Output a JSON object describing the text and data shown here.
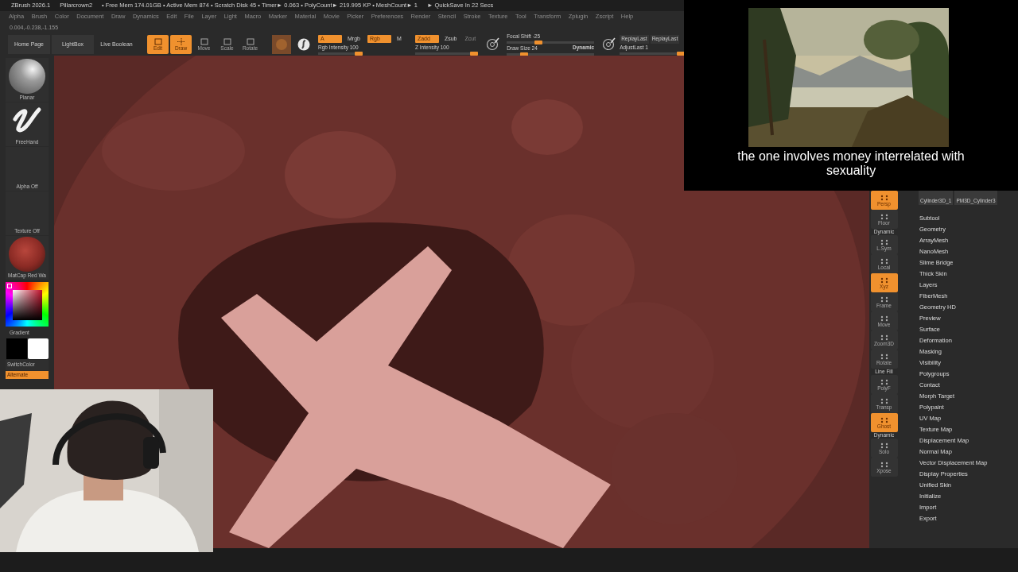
{
  "title_bar": {
    "app": "ZBrush 2026.1",
    "document": "Pillarcrown2",
    "stats": "• Free Mem 174.01GB • Active Mem 874 • Scratch Disk 45 • Timer► 0.063 • PolyCount► 219.995 KP • MeshCount► 1",
    "quicksave": "► QuickSave In 22 Secs"
  },
  "menu": [
    "Alpha",
    "Brush",
    "Color",
    "Document",
    "Draw",
    "Dynamics",
    "Edit",
    "File",
    "Layer",
    "Light",
    "Macro",
    "Marker",
    "Material",
    "Movie",
    "Picker",
    "Preferences",
    "Render",
    "Stencil",
    "Stroke",
    "Texture",
    "Tool",
    "Transform",
    "Zplugin",
    "Zscript",
    "Help"
  ],
  "coordinates": "0.004,-0.238,-1.155",
  "toolbar": {
    "nav_buttons": [
      "Home Page",
      "LightBox",
      "Live Boolean"
    ],
    "modes": [
      {
        "label": "Edit",
        "selected": true
      },
      {
        "label": "Draw",
        "selected": true
      },
      {
        "label": "Move",
        "selected": false
      },
      {
        "label": "Scale",
        "selected": false
      },
      {
        "label": "Rotate",
        "selected": false
      }
    ],
    "color_toggles": [
      {
        "label": "A",
        "selected": true
      },
      {
        "label": "Mrgb",
        "selected": false
      },
      {
        "label": "Rgb",
        "selected": true
      },
      {
        "label": "M",
        "selected": false
      }
    ],
    "z_toggles": [
      {
        "label": "Zadd",
        "selected": true,
        "disabled": false
      },
      {
        "label": "Zsub",
        "selected": false,
        "disabled": false
      },
      {
        "label": "Zcut",
        "selected": false,
        "disabled": true
      }
    ],
    "rgb_intensity": {
      "label": "Rgb Intensity 100",
      "level": 1
    },
    "z_intensity": {
      "label": "Z Intensity 100",
      "level": 1
    },
    "focal_shift": {
      "label": "Focal Shift -25",
      "level": 0.35
    },
    "draw_size": {
      "label": "Draw Size 24",
      "level": 0.17
    },
    "dynamic": "Dynamic",
    "replay_buttons": [
      "ReplayLast",
      "ReplayLast"
    ],
    "adjust_last": {
      "label": "AdjustLast 1",
      "level": 0.9
    }
  },
  "left_shelf": {
    "thumbs": [
      {
        "label": "Planar",
        "kind": "sphere"
      },
      {
        "label": "FreeHand",
        "kind": "stroke"
      },
      {
        "label": "Alpha Off",
        "kind": "empty"
      },
      {
        "label": "Texture Off",
        "kind": "empty"
      },
      {
        "label": "MatCap Red Wa",
        "kind": "matcap"
      }
    ],
    "gradient": "Gradient",
    "switch_color": "SwitchColor",
    "alternate": {
      "label": "Alternate",
      "selected": true
    }
  },
  "right_shelf": [
    {
      "label": "Persp",
      "selected": true
    },
    {
      "label": "Floor",
      "selected": false
    },
    {
      "label": "L.Sym",
      "caption": "Dynamic",
      "selected": false
    },
    {
      "label": "Local",
      "selected": false
    },
    {
      "label": "Xyz",
      "selected": true
    },
    {
      "label": "Frame",
      "selected": false
    },
    {
      "label": "Move",
      "selected": false
    },
    {
      "label": "Zoom3D",
      "selected": false
    },
    {
      "label": "Rotate",
      "selected": false
    },
    {
      "label": "PolyF",
      "caption": "Line Fill",
      "selected": false
    },
    {
      "label": "Transp",
      "selected": false
    },
    {
      "label": "Ghost",
      "selected": true
    },
    {
      "label": "Solo",
      "caption": "Dynamic",
      "selected": false
    },
    {
      "label": "Xpose",
      "selected": false
    }
  ],
  "tool_panel": {
    "subtools": [
      "Cylinder3D_1",
      "PM3D_Cylinder3"
    ],
    "items": [
      "Subtool",
      "Geometry",
      "ArrayMesh",
      "NanoMesh",
      "Slime Bridge",
      "Thick Skin",
      "Layers",
      "FiberMesh",
      "Geometry HD",
      "Preview",
      "Surface",
      "Deformation",
      "Masking",
      "Visibility",
      "Polygroups",
      "Contact",
      "Morph Target",
      "Polypaint",
      "UV Map",
      "Texture Map",
      "Displacement Map",
      "Normal Map",
      "Vector Displacement Map",
      "Display Properties",
      "Unified Skin",
      "Initialize",
      "Import",
      "Export"
    ]
  },
  "overlay": {
    "caption": "the one involves money interrelated with sexuality"
  }
}
